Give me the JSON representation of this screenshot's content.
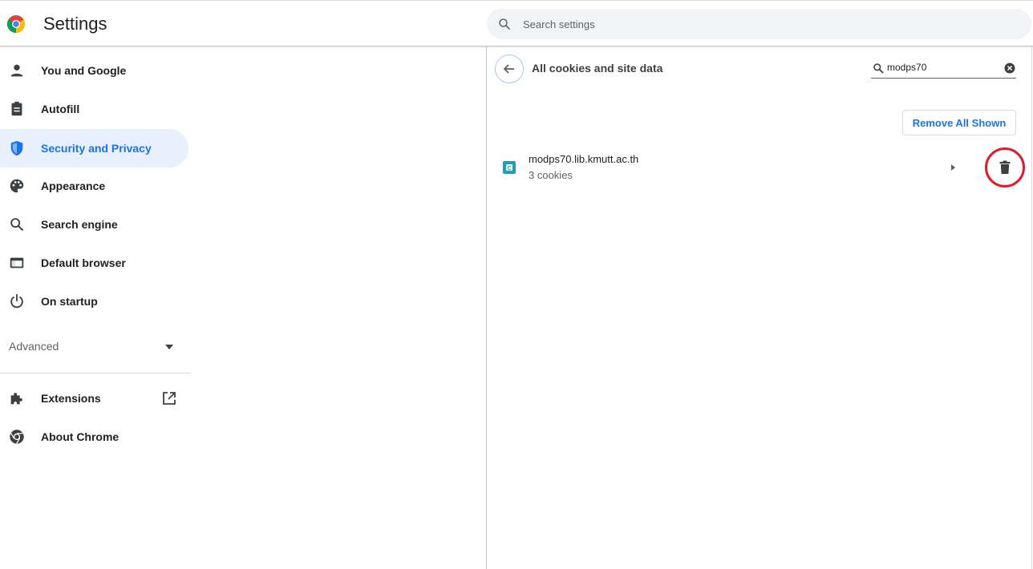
{
  "header": {
    "title": "Settings",
    "search_placeholder": "Search settings"
  },
  "sidebar": {
    "items": [
      {
        "label": "You and Google",
        "icon": "person-icon"
      },
      {
        "label": "Autofill",
        "icon": "clipboard-icon"
      },
      {
        "label": "Security and Privacy",
        "icon": "shield-icon",
        "active": true
      },
      {
        "label": "Appearance",
        "icon": "palette-icon"
      },
      {
        "label": "Search engine",
        "icon": "search-icon"
      },
      {
        "label": "Default browser",
        "icon": "browser-window-icon"
      },
      {
        "label": "On startup",
        "icon": "power-icon"
      }
    ],
    "advanced_label": "Advanced",
    "bottom_items": [
      {
        "label": "Extensions",
        "icon": "puzzle-icon",
        "external": true
      },
      {
        "label": "About Chrome",
        "icon": "chrome-icon"
      }
    ]
  },
  "subpage": {
    "title": "All cookies and site data",
    "filter_value": "modps70",
    "remove_all_label": "Remove All Shown",
    "sites": [
      {
        "name": "modps70.lib.kmutt.ac.th",
        "cookies": "3 cookies"
      }
    ]
  },
  "colors": {
    "accent": "#1a73e8",
    "active_bg": "#e8f0fe",
    "highlight_circle": "#e01b2a",
    "favicon": "#17a2b8"
  }
}
